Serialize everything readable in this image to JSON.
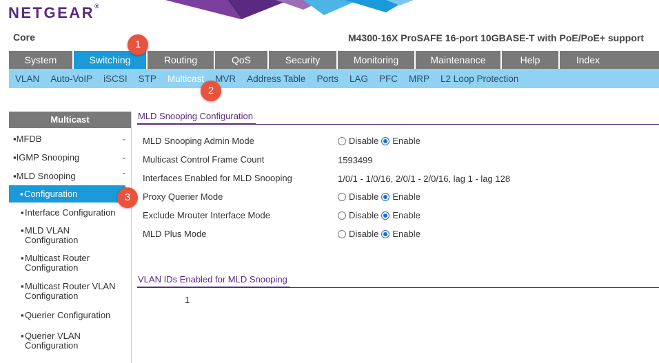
{
  "brand": {
    "logo": "NETGEAR",
    "logo_mark": "®"
  },
  "header": {
    "site": "Core",
    "model": "M4300-16X ProSAFE 16-port 10GBASE-T with PoE/PoE+ support"
  },
  "main_nav": [
    {
      "label": "System",
      "active": false
    },
    {
      "label": "Switching",
      "active": true
    },
    {
      "label": "Routing",
      "active": false
    },
    {
      "label": "QoS",
      "active": false
    },
    {
      "label": "Security",
      "active": false
    },
    {
      "label": "Monitoring",
      "active": false
    },
    {
      "label": "Maintenance",
      "active": false
    },
    {
      "label": "Help",
      "active": false
    },
    {
      "label": "Index",
      "active": false
    }
  ],
  "sub_nav": [
    {
      "label": "VLAN",
      "active": false
    },
    {
      "label": "Auto-VoIP",
      "active": false
    },
    {
      "label": "iSCSI",
      "active": false
    },
    {
      "label": "STP",
      "active": false
    },
    {
      "label": "Multicast",
      "active": true
    },
    {
      "label": "MVR",
      "active": false
    },
    {
      "label": "Address Table",
      "active": false
    },
    {
      "label": "Ports",
      "active": false
    },
    {
      "label": "LAG",
      "active": false
    },
    {
      "label": "PFC",
      "active": false
    },
    {
      "label": "MRP",
      "active": false
    },
    {
      "label": "L2 Loop Protection",
      "active": false
    }
  ],
  "sidebar": {
    "title": "Multicast",
    "groups": [
      {
        "label": "MFDB",
        "expanded": false
      },
      {
        "label": "IGMP Snooping",
        "expanded": false
      },
      {
        "label": "MLD Snooping",
        "expanded": true
      }
    ],
    "items": [
      {
        "label": "Configuration",
        "active": true
      },
      {
        "label": "Interface Configuration",
        "active": false
      },
      {
        "label": "MLD VLAN Configuration",
        "active": false
      },
      {
        "label": "Multicast Router Configuration",
        "active": false
      },
      {
        "label": "Multicast Router VLAN Configuration",
        "active": false
      },
      {
        "label": "Querier Configuration",
        "active": false
      },
      {
        "label": "Querier VLAN Configuration",
        "active": false
      }
    ]
  },
  "config_section": {
    "title": "MLD Snooping Configuration",
    "rows": [
      {
        "label": "MLD Snooping Admin Mode",
        "type": "radio",
        "selected": "Enable"
      },
      {
        "label": "Multicast Control Frame Count",
        "type": "text",
        "value": "1593499"
      },
      {
        "label": "Interfaces Enabled for MLD Snooping",
        "type": "text",
        "value": "1/0/1 - 1/0/16, 2/0/1 - 2/0/16, lag 1 - lag 128"
      },
      {
        "label": "Proxy Querier Mode",
        "type": "radio",
        "selected": "Enable"
      },
      {
        "label": "Exclude Mrouter Interface Mode",
        "type": "radio",
        "selected": "Enable"
      },
      {
        "label": "MLD Plus Mode",
        "type": "radio",
        "selected": "Enable"
      }
    ],
    "option_disable": "Disable",
    "option_enable": "Enable"
  },
  "vlan_section": {
    "title": "VLAN IDs Enabled for MLD Snooping",
    "value": "1"
  },
  "callouts": [
    "1",
    "2",
    "3"
  ],
  "colors": {
    "brand_purple": "#5a2a82",
    "nav_gray": "#797979",
    "active_blue": "#1a9ad9",
    "subnav_light_blue": "#8fd2f3",
    "callout_red": "#e8533d"
  }
}
